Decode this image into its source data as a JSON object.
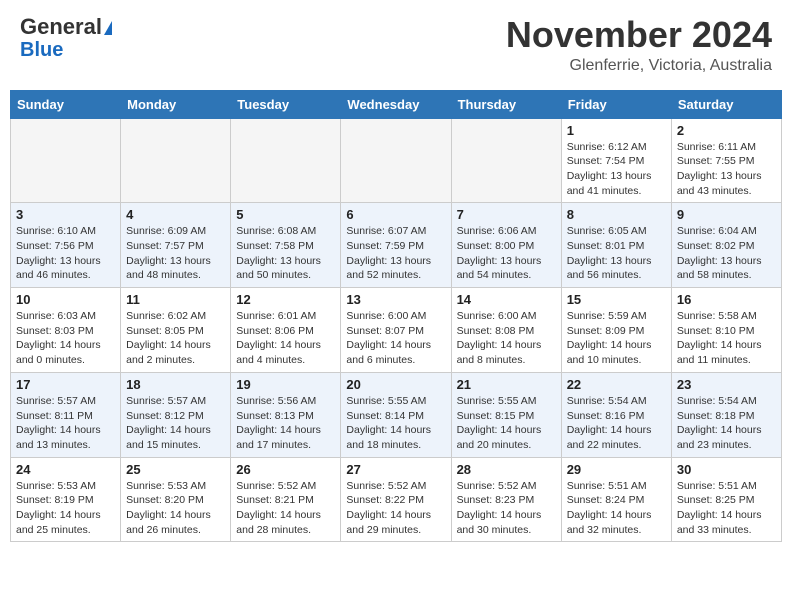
{
  "header": {
    "logo_line1": "General",
    "logo_line2": "Blue",
    "month": "November 2024",
    "location": "Glenferrie, Victoria, Australia"
  },
  "weekdays": [
    "Sunday",
    "Monday",
    "Tuesday",
    "Wednesday",
    "Thursday",
    "Friday",
    "Saturday"
  ],
  "weeks": [
    [
      {
        "day": "",
        "info": ""
      },
      {
        "day": "",
        "info": ""
      },
      {
        "day": "",
        "info": ""
      },
      {
        "day": "",
        "info": ""
      },
      {
        "day": "",
        "info": ""
      },
      {
        "day": "1",
        "info": "Sunrise: 6:12 AM\nSunset: 7:54 PM\nDaylight: 13 hours\nand 41 minutes."
      },
      {
        "day": "2",
        "info": "Sunrise: 6:11 AM\nSunset: 7:55 PM\nDaylight: 13 hours\nand 43 minutes."
      }
    ],
    [
      {
        "day": "3",
        "info": "Sunrise: 6:10 AM\nSunset: 7:56 PM\nDaylight: 13 hours\nand 46 minutes."
      },
      {
        "day": "4",
        "info": "Sunrise: 6:09 AM\nSunset: 7:57 PM\nDaylight: 13 hours\nand 48 minutes."
      },
      {
        "day": "5",
        "info": "Sunrise: 6:08 AM\nSunset: 7:58 PM\nDaylight: 13 hours\nand 50 minutes."
      },
      {
        "day": "6",
        "info": "Sunrise: 6:07 AM\nSunset: 7:59 PM\nDaylight: 13 hours\nand 52 minutes."
      },
      {
        "day": "7",
        "info": "Sunrise: 6:06 AM\nSunset: 8:00 PM\nDaylight: 13 hours\nand 54 minutes."
      },
      {
        "day": "8",
        "info": "Sunrise: 6:05 AM\nSunset: 8:01 PM\nDaylight: 13 hours\nand 56 minutes."
      },
      {
        "day": "9",
        "info": "Sunrise: 6:04 AM\nSunset: 8:02 PM\nDaylight: 13 hours\nand 58 minutes."
      }
    ],
    [
      {
        "day": "10",
        "info": "Sunrise: 6:03 AM\nSunset: 8:03 PM\nDaylight: 14 hours\nand 0 minutes."
      },
      {
        "day": "11",
        "info": "Sunrise: 6:02 AM\nSunset: 8:05 PM\nDaylight: 14 hours\nand 2 minutes."
      },
      {
        "day": "12",
        "info": "Sunrise: 6:01 AM\nSunset: 8:06 PM\nDaylight: 14 hours\nand 4 minutes."
      },
      {
        "day": "13",
        "info": "Sunrise: 6:00 AM\nSunset: 8:07 PM\nDaylight: 14 hours\nand 6 minutes."
      },
      {
        "day": "14",
        "info": "Sunrise: 6:00 AM\nSunset: 8:08 PM\nDaylight: 14 hours\nand 8 minutes."
      },
      {
        "day": "15",
        "info": "Sunrise: 5:59 AM\nSunset: 8:09 PM\nDaylight: 14 hours\nand 10 minutes."
      },
      {
        "day": "16",
        "info": "Sunrise: 5:58 AM\nSunset: 8:10 PM\nDaylight: 14 hours\nand 11 minutes."
      }
    ],
    [
      {
        "day": "17",
        "info": "Sunrise: 5:57 AM\nSunset: 8:11 PM\nDaylight: 14 hours\nand 13 minutes."
      },
      {
        "day": "18",
        "info": "Sunrise: 5:57 AM\nSunset: 8:12 PM\nDaylight: 14 hours\nand 15 minutes."
      },
      {
        "day": "19",
        "info": "Sunrise: 5:56 AM\nSunset: 8:13 PM\nDaylight: 14 hours\nand 17 minutes."
      },
      {
        "day": "20",
        "info": "Sunrise: 5:55 AM\nSunset: 8:14 PM\nDaylight: 14 hours\nand 18 minutes."
      },
      {
        "day": "21",
        "info": "Sunrise: 5:55 AM\nSunset: 8:15 PM\nDaylight: 14 hours\nand 20 minutes."
      },
      {
        "day": "22",
        "info": "Sunrise: 5:54 AM\nSunset: 8:16 PM\nDaylight: 14 hours\nand 22 minutes."
      },
      {
        "day": "23",
        "info": "Sunrise: 5:54 AM\nSunset: 8:18 PM\nDaylight: 14 hours\nand 23 minutes."
      }
    ],
    [
      {
        "day": "24",
        "info": "Sunrise: 5:53 AM\nSunset: 8:19 PM\nDaylight: 14 hours\nand 25 minutes."
      },
      {
        "day": "25",
        "info": "Sunrise: 5:53 AM\nSunset: 8:20 PM\nDaylight: 14 hours\nand 26 minutes."
      },
      {
        "day": "26",
        "info": "Sunrise: 5:52 AM\nSunset: 8:21 PM\nDaylight: 14 hours\nand 28 minutes."
      },
      {
        "day": "27",
        "info": "Sunrise: 5:52 AM\nSunset: 8:22 PM\nDaylight: 14 hours\nand 29 minutes."
      },
      {
        "day": "28",
        "info": "Sunrise: 5:52 AM\nSunset: 8:23 PM\nDaylight: 14 hours\nand 30 minutes."
      },
      {
        "day": "29",
        "info": "Sunrise: 5:51 AM\nSunset: 8:24 PM\nDaylight: 14 hours\nand 32 minutes."
      },
      {
        "day": "30",
        "info": "Sunrise: 5:51 AM\nSunset: 8:25 PM\nDaylight: 14 hours\nand 33 minutes."
      }
    ]
  ]
}
